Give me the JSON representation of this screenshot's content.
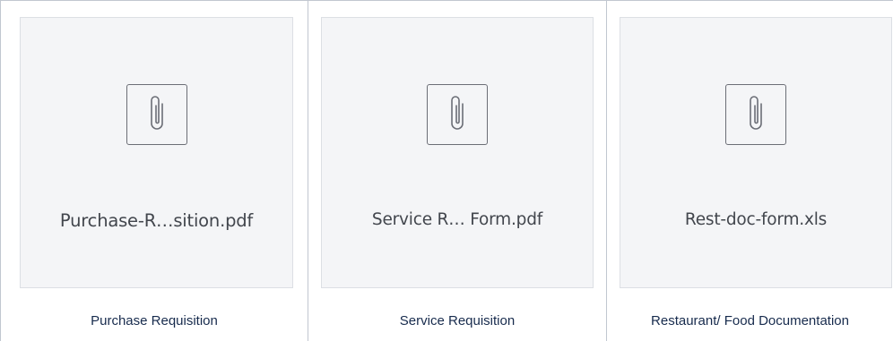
{
  "attachments": [
    {
      "file_name": "Purchase-R…sition.pdf",
      "caption": "Purchase Requisition",
      "icon": "paperclip-icon"
    },
    {
      "file_name": "Service R… Form.pdf",
      "caption": "Service Requisition",
      "icon": "paperclip-icon"
    },
    {
      "file_name": "Rest-doc-form.xls",
      "caption": "Restaurant/ Food Documentation",
      "icon": "paperclip-icon"
    }
  ],
  "colors": {
    "tile_background": "#f4f5f7",
    "border": "#c1c7d0",
    "icon_stroke": "#6b6e76",
    "filename_text": "#42464d",
    "caption_text": "#172b4d"
  }
}
